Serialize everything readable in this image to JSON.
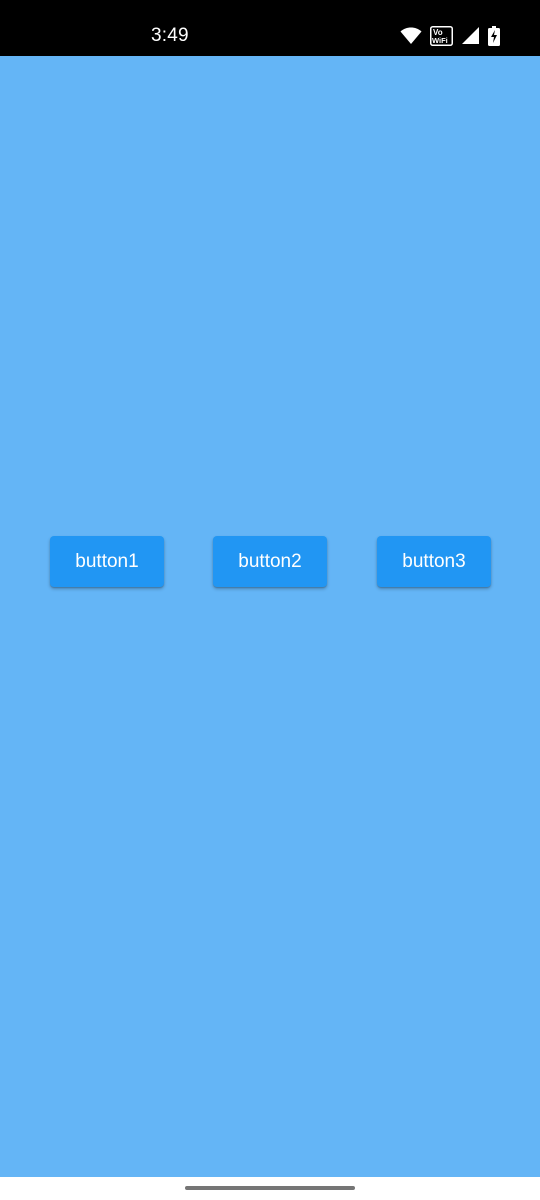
{
  "status_bar": {
    "time": "3:49",
    "icons": [
      "wifi-icon",
      "vowifi-icon",
      "cellular-signal-icon",
      "battery-charging-icon"
    ],
    "vowifi_top": "Vo",
    "vowifi_bottom": "WiFi"
  },
  "colors": {
    "status_bar_bg": "#000000",
    "background": "#64b5f6",
    "button_bg": "#2196f3",
    "button_text": "#ffffff",
    "nav_handle": "#757575"
  },
  "buttons": [
    {
      "label": "button1"
    },
    {
      "label": "button2"
    },
    {
      "label": "button3"
    }
  ]
}
